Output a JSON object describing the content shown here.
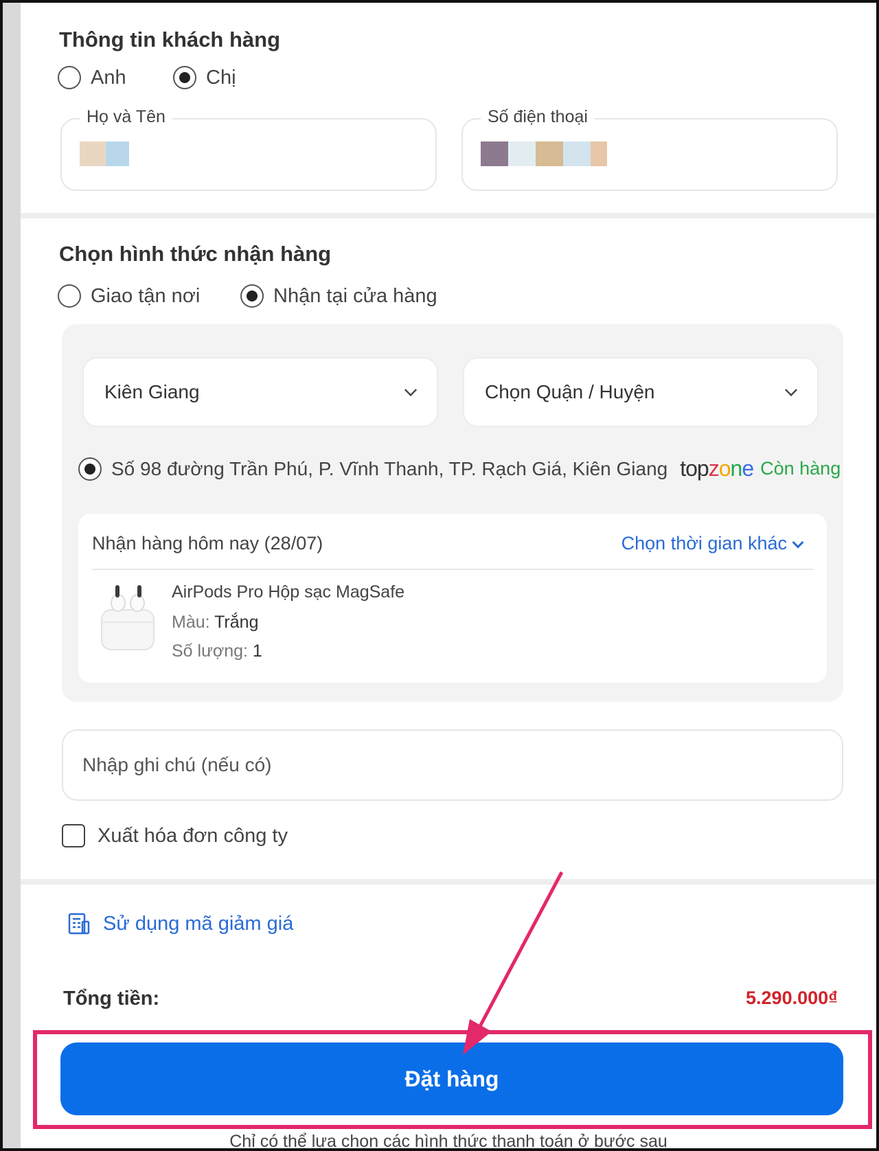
{
  "customer": {
    "title": "Thông tin khách hàng",
    "salutations": [
      {
        "label": "Anh",
        "selected": false
      },
      {
        "label": "Chị",
        "selected": true
      }
    ],
    "name_field": {
      "legend": "Họ và Tên"
    },
    "phone_field": {
      "legend": "Số điện thoại"
    }
  },
  "receive": {
    "title": "Chọn hình thức nhận hàng",
    "options": [
      {
        "label": "Giao tận nơi",
        "selected": false
      },
      {
        "label": "Nhận tại cửa hàng",
        "selected": true
      }
    ],
    "province_select": "Kiên Giang",
    "district_select": "Chọn Quận / Huyện",
    "store": {
      "address": "Số 98 đường Trần Phú, P. Vĩnh Thanh, TP. Rạch Giá, Kiên Giang",
      "brand": "topzone",
      "stock": "Còn hàng",
      "selected": true
    },
    "delivery": {
      "heading": "Nhận hàng hôm nay (28/07)",
      "change_time": "Chọn thời gian khác",
      "product": {
        "name": "AirPods Pro Hộp sạc MagSafe",
        "color_label": "Màu:",
        "color_value": "Trắng",
        "qty_label": "Số lượng:",
        "qty_value": "1"
      }
    }
  },
  "note": {
    "placeholder": "Nhập ghi chú (nếu có)"
  },
  "invoice": {
    "label": "Xuất hóa đơn công ty",
    "checked": false
  },
  "coupon": {
    "label": "Sử dụng mã giảm giá"
  },
  "total": {
    "label": "Tổng tiền:",
    "value": "5.290.000₫"
  },
  "order_button": "Đặt hàng",
  "footnote": "Chỉ có thể lựa chọn các hình thức thanh toán ở bước sau",
  "colors": {
    "primary": "#0a6ee8",
    "price": "#d0242b",
    "stock": "#2aa84a",
    "highlight": "#e3286b"
  }
}
